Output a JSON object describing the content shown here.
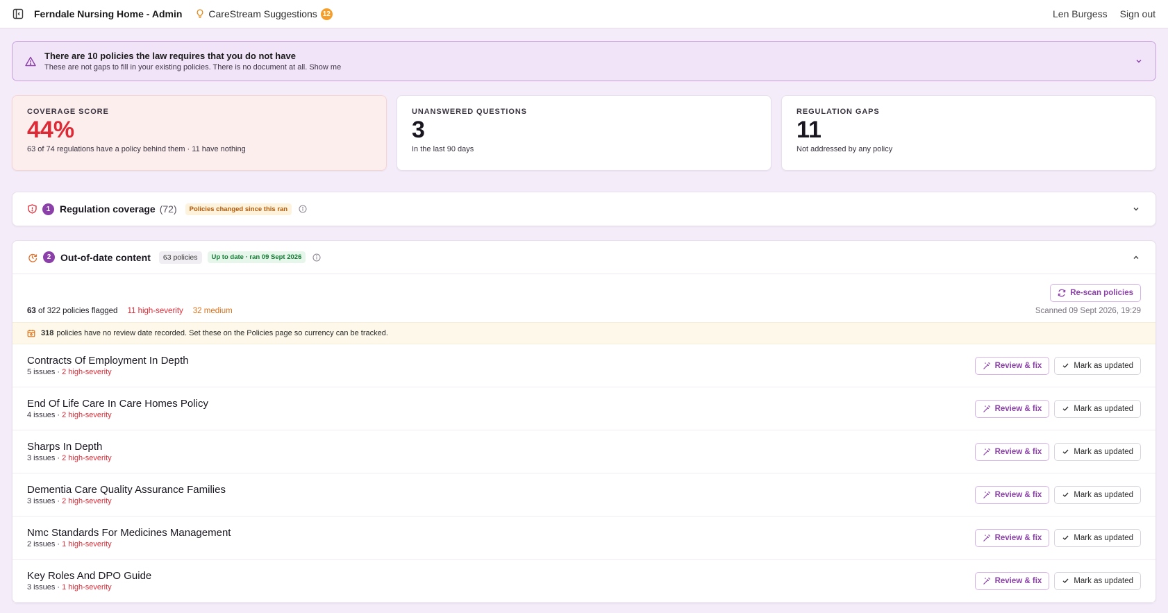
{
  "topbar": {
    "app_title": "Ferndale Nursing Home - Admin",
    "suggestions_label": "CareStream Suggestions",
    "suggestions_count": "12",
    "user_name": "Len Burgess",
    "signout_label": "Sign out"
  },
  "alert": {
    "title": "There are 10 policies the law requires that you do not have",
    "subtitle": "These are not gaps to fill in your existing policies. There is no document at all. Show me"
  },
  "stats": [
    {
      "label": "COVERAGE SCORE",
      "value": "44%",
      "desc": "63 of 74 regulations have a policy behind them · 11 have nothing"
    },
    {
      "label": "UNANSWERED QUESTIONS",
      "value": "3",
      "desc": "In the last 90 days"
    },
    {
      "label": "REGULATION GAPS",
      "value": "11",
      "desc": "Not addressed by any policy"
    }
  ],
  "regulation_section": {
    "number": "1",
    "title": "Regulation coverage",
    "count": "(72)",
    "pill": "Policies changed since this ran"
  },
  "outdated_section": {
    "number": "2",
    "title": "Out-of-date content",
    "count_pill": "63 policies",
    "status_pill": "Up to date · ran 09 Sept 2026",
    "rescan_label": "Re-scan policies",
    "flagged_num": "63",
    "flagged_rest": "of 322 policies flagged",
    "high_count": "11 high-severity",
    "medium_count": "32 medium",
    "scanned": "Scanned 09 Sept 2026, 19:29",
    "notice_num": "318",
    "notice_text": "policies have no review date recorded. Set these on the Policies page so currency can be tracked.",
    "review_label": "Review & fix",
    "mark_label": "Mark as updated",
    "policies": [
      {
        "name": "Contracts Of Employment In Depth",
        "issues": "5 issues · ",
        "severity": "2 high-severity"
      },
      {
        "name": "End Of Life Care In Care Homes Policy",
        "issues": "4 issues · ",
        "severity": "2 high-severity"
      },
      {
        "name": "Sharps In Depth",
        "issues": "3 issues · ",
        "severity": "2 high-severity"
      },
      {
        "name": "Dementia Care Quality Assurance Families",
        "issues": "3 issues · ",
        "severity": "2 high-severity"
      },
      {
        "name": "Nmc Standards For Medicines Management",
        "issues": "2 issues · ",
        "severity": "1 high-severity"
      },
      {
        "name": "Key Roles And DPO Guide",
        "issues": "3 issues · ",
        "severity": "1 high-severity"
      }
    ]
  },
  "colors": {
    "accent": "#8b3fa8",
    "danger": "#dc2a36",
    "warning": "#d9711a",
    "success": "#127a33",
    "badge": "#f59e2a"
  }
}
